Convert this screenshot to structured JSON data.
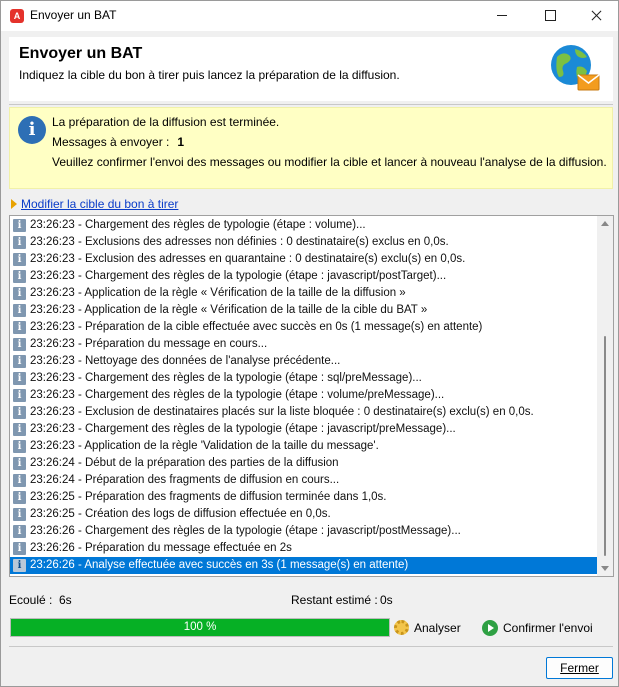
{
  "window": {
    "title": "Envoyer un BAT",
    "app_icon": "adobe-icon"
  },
  "header": {
    "title": "Envoyer un BAT",
    "subtitle": "Indiquez la cible du bon à tirer puis lancez la préparation de la diffusion.",
    "icon": "globe-mail-icon"
  },
  "info": {
    "line1": "La préparation de la diffusion est terminée.",
    "messages_label": "Messages à envoyer :",
    "messages_count": "1",
    "line3": "Veuillez confirmer l'envoi des messages ou modifier la cible et lancer à nouveau l'analyse de la diffusion."
  },
  "link": {
    "label": "Modifier la cible du bon à tirer"
  },
  "log": [
    "23:26:23 - Chargement des règles de typologie (étape : volume)...",
    "23:26:23 - Exclusions des adresses non définies : 0 destinataire(s) exclus en 0,0s.",
    "23:26:23 - Exclusion des adresses en quarantaine : 0 destinataire(s) exclu(s) en 0,0s.",
    "23:26:23 - Chargement des règles de la typologie (étape : javascript/postTarget)...",
    "23:26:23 - Application de la règle « Vérification de la taille de la diffusion »",
    "23:26:23 - Application de la règle « Vérification de la taille de la cible du BAT »",
    "23:26:23 - Préparation de la cible effectuée avec succès en 0s (1 message(s) en attente)",
    "23:26:23 - Préparation du message en cours...",
    "23:26:23 - Nettoyage des données de l'analyse précédente...",
    "23:26:23 - Chargement des règles de la typologie (étape : sql/preMessage)...",
    "23:26:23 - Chargement des règles de la typologie (étape : volume/preMessage)...",
    "23:26:23 - Exclusion de destinataires placés sur la liste bloquée : 0 destinataire(s) exclu(s) en 0,0s.",
    "23:26:23 - Chargement des règles de la typologie (étape : javascript/preMessage)...",
    "23:26:23 - Application de la règle 'Validation de la taille du message'.",
    "23:26:24 - Début de la préparation des parties de la diffusion",
    "23:26:24 - Préparation des fragments de diffusion en cours...",
    "23:26:25 - Préparation des fragments de diffusion terminée dans 1,0s.",
    "23:26:25 - Création des logs de diffusion effectuée en 0,0s.",
    "23:26:26 - Chargement des règles de la typologie (étape : javascript/postMessage)...",
    "23:26:26 - Préparation du message effectuée en 2s",
    "23:26:26 - Analyse effectuée avec succès en 3s (1 message(s) en attente)"
  ],
  "selected_index": 20,
  "status": {
    "elapsed_label": "Ecoulé :",
    "elapsed_value": "6s",
    "remaining_label": "Restant estimé :",
    "remaining_value": "0s"
  },
  "progress": {
    "value": 1.0,
    "label": "100 %"
  },
  "buttons": {
    "analyse": "Analyser",
    "confirm": "Confirmer l'envoi",
    "close": "Fermer"
  },
  "colors": {
    "progress": "#06b025",
    "selection": "#0078d7",
    "info_bg": "#ffffc4",
    "link": "#0a3cc8"
  }
}
